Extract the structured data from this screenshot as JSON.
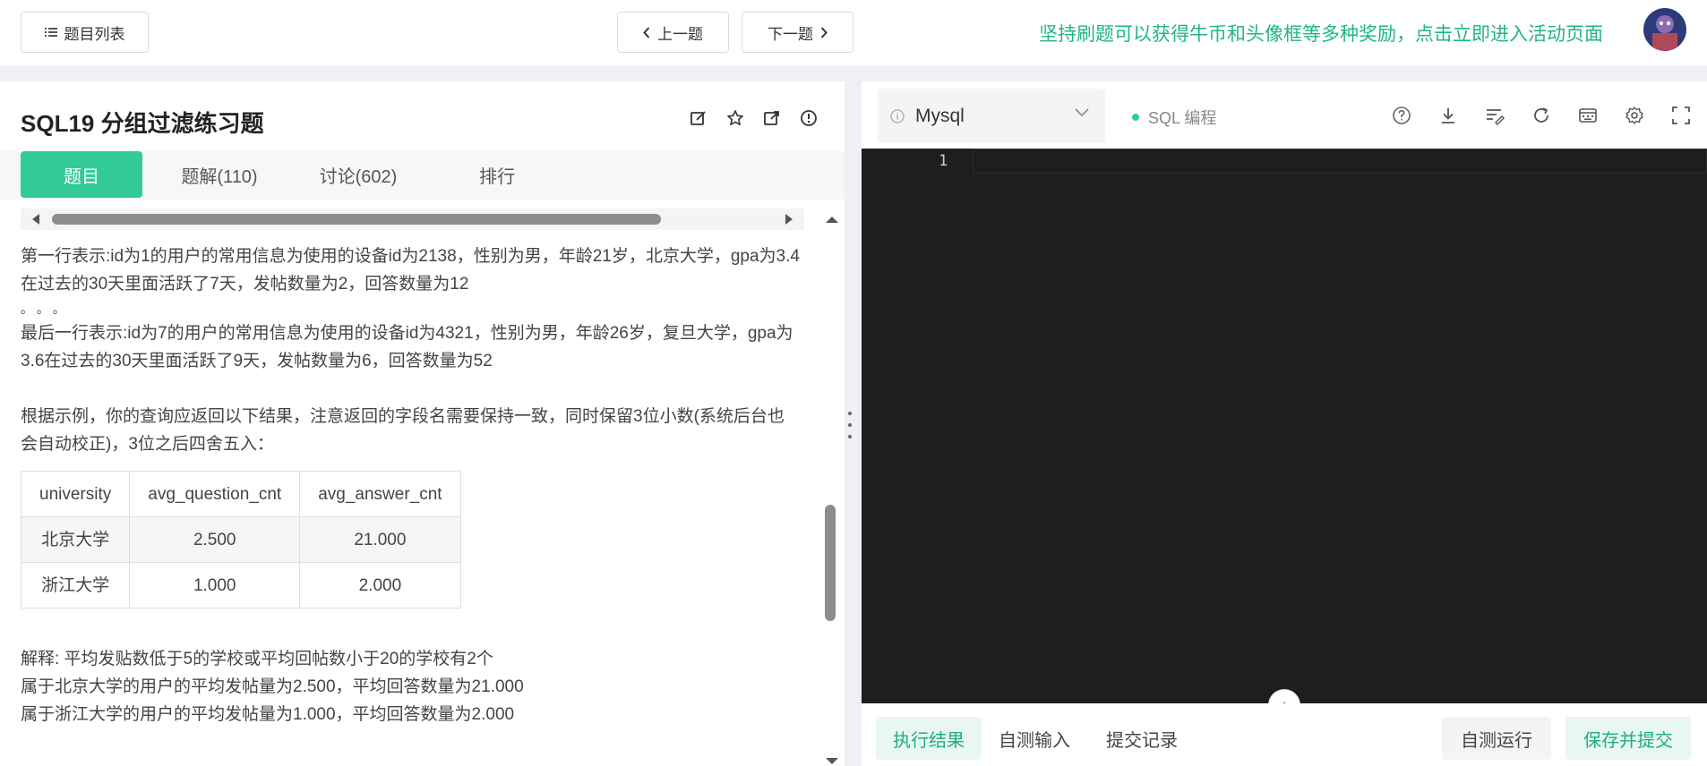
{
  "topbar": {
    "question_list_label": "题目列表",
    "prev_label": "上一题",
    "next_label": "下一题",
    "promo_text": "坚持刷题可以获得牛币和头像框等多种奖励，点击立即进入活动页面"
  },
  "question": {
    "title": "SQL19  分组过滤练习题",
    "icons": [
      "edit-icon",
      "star-icon",
      "external-link-icon",
      "report-icon"
    ]
  },
  "tabs": [
    {
      "label": "题目",
      "active": true
    },
    {
      "label": "题解(110)",
      "active": false
    },
    {
      "label": "讨论(602)",
      "active": false
    },
    {
      "label": "排行",
      "active": false
    }
  ],
  "content": {
    "line1": "第一行表示:id为1的用户的常用信息为使用的设备id为2138，性别为男，年龄21岁，北京大学，gpa为3.4在过去的30天里面活跃了7天，发帖数量为2，回答数量为12",
    "dots": "。 。 。",
    "line_last": "最后一行表示:id为7的用户的常用信息为使用的设备id为4321，性别为男，年龄26岁，复旦大学，gpa为3.6在过去的30天里面活跃了9天，发帖数量为6，回答数量为52",
    "instruction": "根据示例，你的查询应返回以下结果，注意返回的字段名需要保持一致，同时保留3位小数(系统后台也会自动校正)，3位之后四舍五入：",
    "table": {
      "headers": [
        "university",
        "avg_question_cnt",
        "avg_answer_cnt"
      ],
      "rows": [
        [
          "北京大学",
          "2.500",
          "21.000"
        ],
        [
          "浙江大学",
          "1.000",
          "2.000"
        ]
      ]
    },
    "explain1": "解释: 平均发贴数低于5的学校或平均回帖数小于20的学校有2个",
    "explain2": "属于北京大学的用户的平均发帖量为2.500，平均回答数量为21.000",
    "explain3": "属于浙江大学的用户的平均发帖量为1.000，平均回答数量为2.000"
  },
  "editor": {
    "language": "Mysql",
    "mode_label": "SQL 编程",
    "line_number": "1",
    "tool_icons": [
      "help-icon",
      "download-icon",
      "format-icon",
      "reset-icon",
      "keyboard-icon",
      "settings-icon",
      "fullscreen-icon"
    ]
  },
  "bottom": {
    "tabs": [
      "执行结果",
      "自测输入",
      "提交记录"
    ],
    "run_label": "自测运行",
    "submit_label": "保存并提交"
  },
  "colors": {
    "accent": "#32ca99",
    "promo": "#21b587",
    "editor_bg": "#1e1e1e"
  }
}
